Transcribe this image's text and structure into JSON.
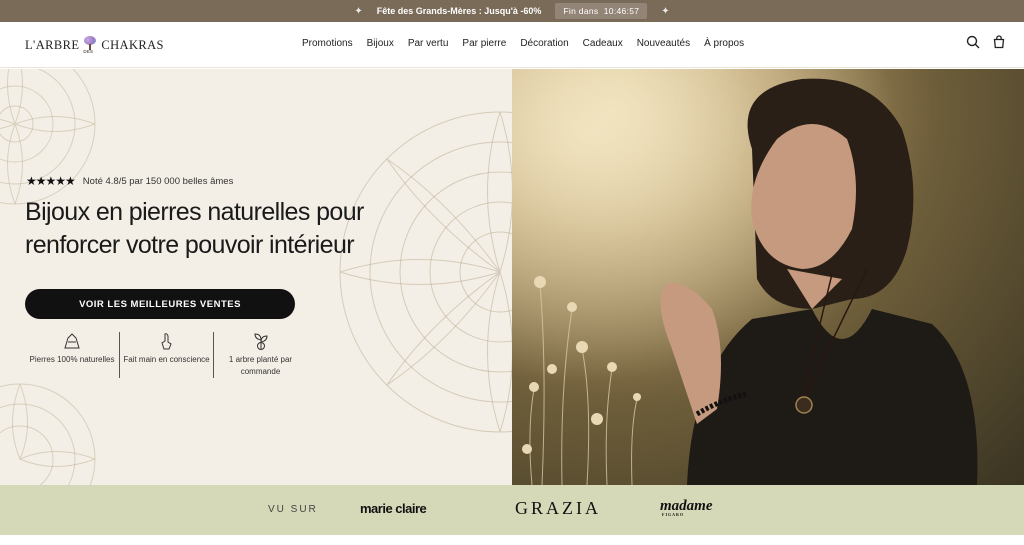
{
  "announcement": {
    "promo": "Fête des Grands-Mères : Jusqu'à -60%",
    "timer_label": "Fin dans",
    "timer_value": "10:46:57"
  },
  "brand": {
    "left": "L'ARBRE",
    "small": "DES",
    "right": "CHAKRAS"
  },
  "nav": [
    "Promotions",
    "Bijoux",
    "Par vertu",
    "Par pierre",
    "Décoration",
    "Cadeaux",
    "Nouveautés",
    "À propos"
  ],
  "icons": {
    "search": "search-icon",
    "cart": "cart-icon"
  },
  "hero": {
    "rating_stars": "★★★★★",
    "rating_value": 4.8,
    "rating_text": "Noté 4.8/5 par 150 000 belles âmes",
    "headline": "Bijoux en pierres naturelles pour renforcer votre pouvoir intérieur",
    "cta": "VOIR LES MEILLEURES VENTES",
    "features": [
      {
        "icon": "stones-icon",
        "text": "Pierres 100% naturelles"
      },
      {
        "icon": "hand-heart-icon",
        "text": "Fait main en conscience"
      },
      {
        "icon": "plant-icon",
        "text": "1 arbre planté par commande"
      }
    ]
  },
  "press": {
    "label": "VU SUR",
    "logos": [
      "marie claire",
      "GRAZIA",
      "madame",
      "FIGARO"
    ]
  },
  "colors": {
    "topbar": "#7a6a58",
    "hero_bg": "#f4efe6",
    "press_bg": "#d6d9b8",
    "cta": "#111111"
  }
}
